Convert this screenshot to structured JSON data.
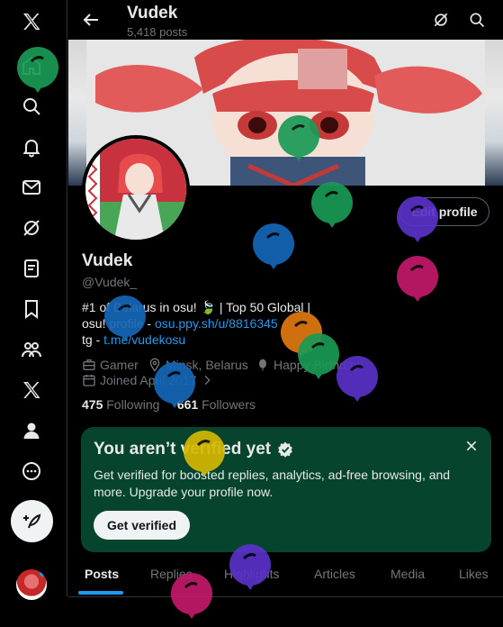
{
  "profile": {
    "name": "Vudek",
    "post_count": "5,418 posts",
    "handle": "@Vudek_",
    "edit_label": "Edit profile",
    "bio_line1": "#1 of Belarus in osu! 🍃 |  Top 50 Global |",
    "bio_line2_prefix": "osu! profile - ",
    "bio_link1": "osu.ppy.sh/u/8816345",
    "bio_line3_prefix": "tg - ",
    "bio_link2": "t.me/vudekosu",
    "category": "Gamer",
    "location": "Minsk, Belarus",
    "birthday": "Happy Birthday!",
    "joined": "Joined April 2017",
    "following_count": "475",
    "following_label": "Following",
    "followers_count": "661",
    "followers_label": "Followers"
  },
  "verify": {
    "title": "You aren’t verified yet",
    "description": "Get verified for boosted replies, analytics, ad-free browsing, and more. Upgrade your profile now.",
    "button": "Get verified"
  },
  "tabs": [
    "Posts",
    "Replies",
    "Highlights",
    "Articles",
    "Media",
    "Likes"
  ],
  "nav_icons": [
    "x-logo-icon",
    "home-icon",
    "search-icon",
    "notifications-icon",
    "messages-icon",
    "grok-icon",
    "lists-icon",
    "bookmarks-icon",
    "communities-icon",
    "premium-icon",
    "profile-icon",
    "more-icon"
  ],
  "colors": {
    "accent": "#1d9bf0",
    "verify_card": "#06442d",
    "balloon_green": "#1a9a55",
    "balloon_blue": "#1566b8",
    "balloon_purple": "#5a32c8",
    "balloon_magenta": "#c41a6b",
    "balloon_orange": "#e07a10",
    "balloon_yellow": "#d6b800"
  }
}
